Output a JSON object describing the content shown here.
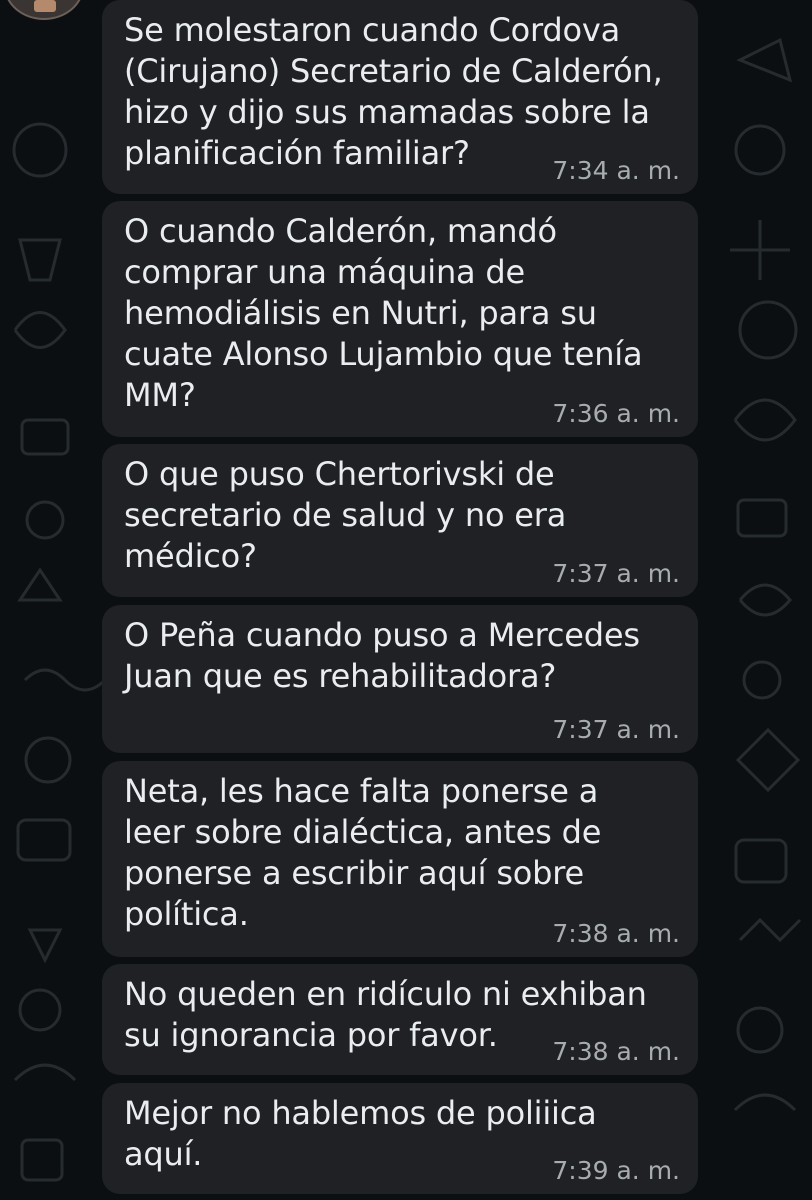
{
  "colors": {
    "background": "#0b0f11",
    "bubble": "#1f2124",
    "text": "#e9edef",
    "timestamp": "#a7acaf",
    "doodle": "#2a2f33"
  },
  "chat": {
    "messages": [
      {
        "text": "Se molestaron cuando Cordova\n(Cirujano) Secretario de Calderón,\nhizo y dijo sus mamadas sobre la\nplanificación familiar?",
        "time": "7:34 a. m."
      },
      {
        "text": "O cuando Calderón, mandó\ncomprar una máquina de\nhemodiálisis en Nutri, para su\ncuate Alonso Lujambio que tenía\nMM?",
        "time": "7:36 a. m."
      },
      {
        "text": "O que puso Chertorivski de\nsecretario de salud y no era\nmédico?",
        "time": "7:37 a. m."
      },
      {
        "text": "O Peña cuando puso a Mercedes\nJuan que es rehabilitadora?",
        "time": "7:37 a. m."
      },
      {
        "text": "Neta, les hace falta ponerse a\nleer sobre dialéctica, antes de\nponerse a escribir aquí sobre\npolítica.",
        "time": "7:38 a. m."
      },
      {
        "text": "No queden en ridículo ni exhiban\nsu ignorancia por favor.",
        "time": "7:38 a. m."
      },
      {
        "text": "Mejor no hablemos de poliiica\naquí.",
        "time": "7:39 a. m."
      }
    ]
  }
}
